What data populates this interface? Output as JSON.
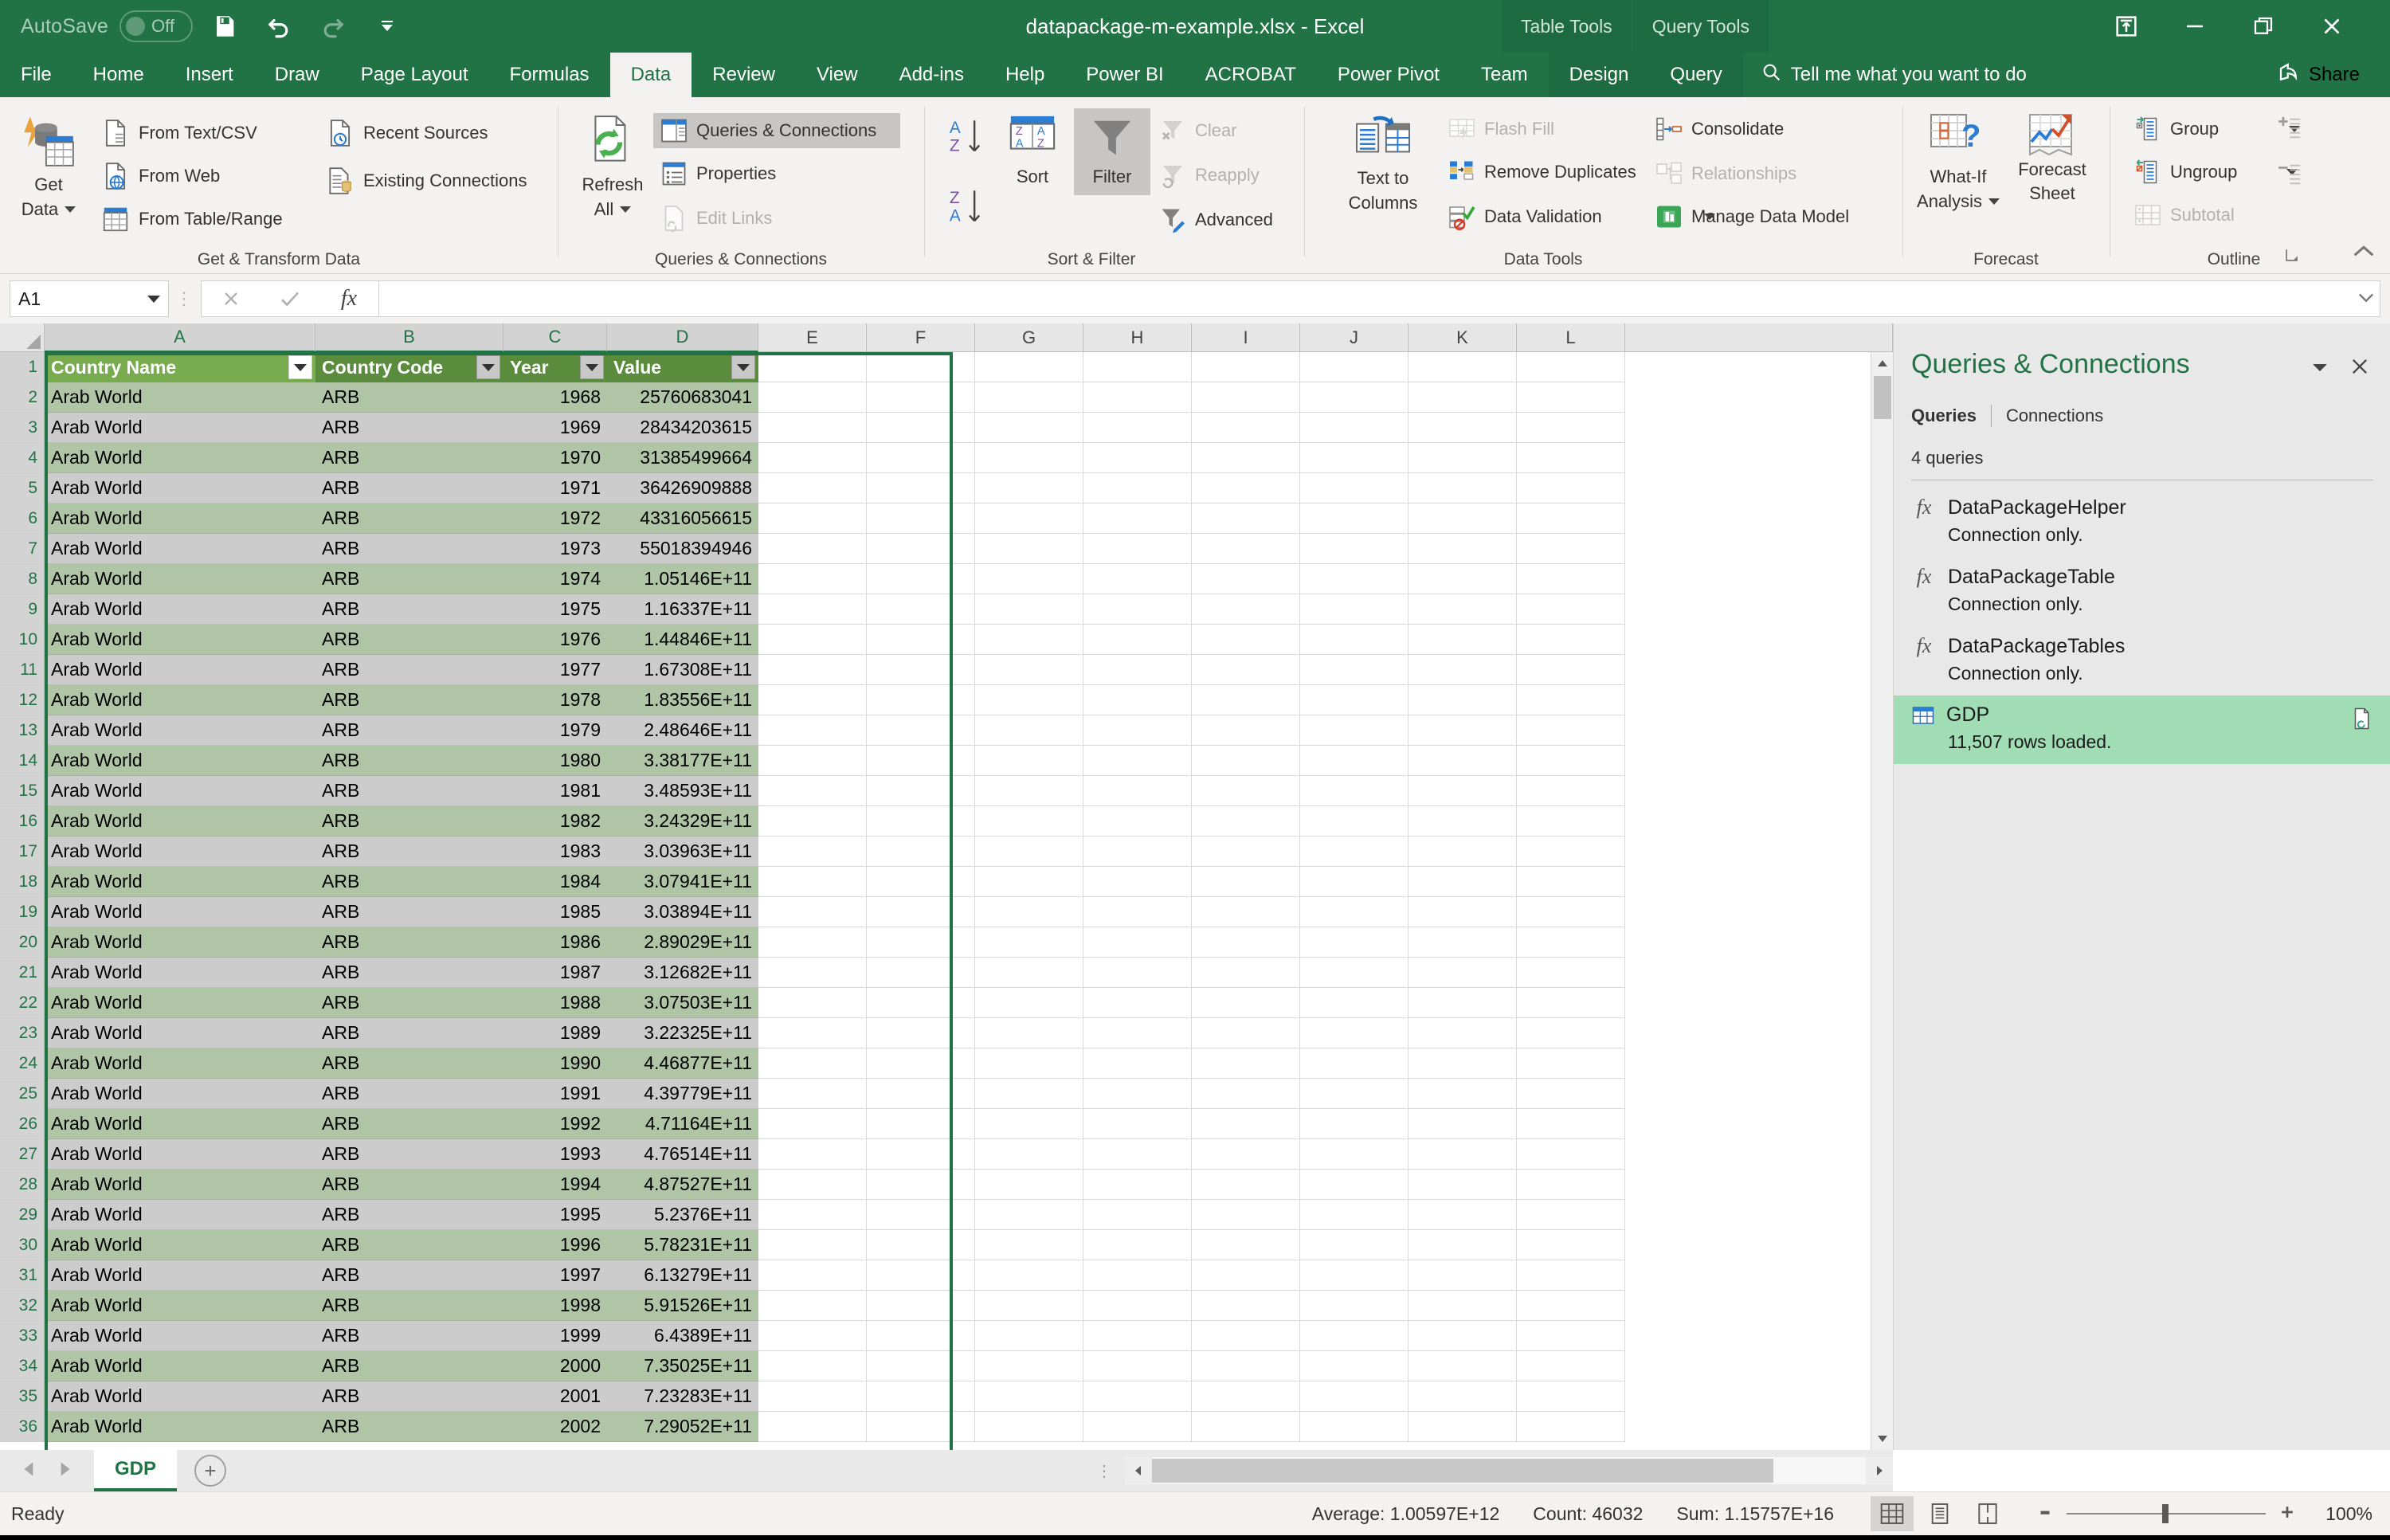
{
  "titlebar": {
    "autosave_label": "AutoSave",
    "autosave_state": "Off",
    "document_title": "datapackage-m-example.xlsx  -  Excel",
    "save_icon": "save-icon",
    "undo_icon": "undo-icon",
    "redo_icon": "redo-icon",
    "customize_qat_icon": "customize-quick-access-toolbar-icon",
    "context_tabs": [
      "Table Tools",
      "Query Tools"
    ],
    "ribbon_display_icon": "ribbon-display-options-icon",
    "minimize_icon": "minimize-icon",
    "restore_icon": "restore-icon",
    "close_icon": "close-icon"
  },
  "ribbon_tabs": {
    "items": [
      "File",
      "Home",
      "Insert",
      "Draw",
      "Page Layout",
      "Formulas",
      "Data",
      "Review",
      "View",
      "Add-ins",
      "Help",
      "Power BI",
      "ACROBAT",
      "Power Pivot",
      "Team"
    ],
    "active": "Data",
    "context_items": [
      "Design",
      "Query"
    ],
    "tell_me": "Tell me what you want to do",
    "tell_me_icon": "search-icon",
    "share_label": "Share",
    "share_icon": "share-icon"
  },
  "ribbon": {
    "groups": [
      {
        "name": "Get & Transform Data",
        "big_buttons": [
          {
            "label_line1": "Get",
            "label_line2": "Data",
            "icon": "get-data-icon",
            "has_caret": true
          }
        ],
        "small_buttons": [
          {
            "label": "From Text/CSV",
            "icon": "from-text-csv-icon",
            "disabled": false
          },
          {
            "label": "From Web",
            "icon": "from-web-icon",
            "disabled": false
          },
          {
            "label": "From Table/Range",
            "icon": "from-table-range-icon",
            "disabled": false
          },
          {
            "label": "Recent Sources",
            "icon": "recent-sources-icon",
            "disabled": false
          },
          {
            "label": "Existing Connections",
            "icon": "existing-connections-icon",
            "disabled": false
          }
        ]
      },
      {
        "name": "Queries & Connections",
        "big_buttons": [
          {
            "label_line1": "Refresh",
            "label_line2": "All",
            "icon": "refresh-all-icon",
            "has_caret": true
          }
        ],
        "small_buttons": [
          {
            "label": "Queries & Connections",
            "icon": "queries-connections-icon",
            "disabled": false,
            "pressed": true
          },
          {
            "label": "Properties",
            "icon": "properties-icon",
            "disabled": false
          },
          {
            "label": "Edit Links",
            "icon": "edit-links-icon",
            "disabled": true
          }
        ]
      },
      {
        "name": "Sort & Filter",
        "big_buttons": [
          {
            "label_line1": "Sort",
            "label_line2": "",
            "icon": "sort-icon",
            "has_caret": false
          },
          {
            "label_line1": "Filter",
            "label_line2": "",
            "icon": "filter-icon",
            "has_caret": false,
            "pressed": true
          }
        ],
        "small_buttons": [
          {
            "label": "Clear",
            "icon": "clear-filter-icon",
            "disabled": true
          },
          {
            "label": "Reapply",
            "icon": "reapply-filter-icon",
            "disabled": true
          },
          {
            "label": "Advanced",
            "icon": "advanced-filter-icon",
            "disabled": false
          }
        ],
        "sort_az_icon": "sort-ascending-icon",
        "sort_za_icon": "sort-descending-icon"
      },
      {
        "name": "Data Tools",
        "big_buttons": [
          {
            "label_line1": "Text to",
            "label_line2": "Columns",
            "icon": "text-to-columns-icon",
            "has_caret": false
          }
        ],
        "small_buttons": [
          {
            "label": "Flash Fill",
            "icon": "flash-fill-icon",
            "disabled": true
          },
          {
            "label": "Remove Duplicates",
            "icon": "remove-duplicates-icon",
            "disabled": false
          },
          {
            "label": "Data Validation",
            "icon": "data-validation-icon",
            "disabled": false,
            "has_caret": true
          },
          {
            "label": "Consolidate",
            "icon": "consolidate-icon",
            "disabled": false
          },
          {
            "label": "Relationships",
            "icon": "relationships-icon",
            "disabled": true
          },
          {
            "label": "Manage Data Model",
            "icon": "manage-data-model-icon",
            "disabled": false
          }
        ]
      },
      {
        "name": "Forecast",
        "big_buttons": [
          {
            "label_line1": "What-If",
            "label_line2": "Analysis",
            "icon": "what-if-analysis-icon",
            "has_caret": true
          },
          {
            "label_line1": "Forecast",
            "label_line2": "Sheet",
            "icon": "forecast-sheet-icon",
            "has_caret": false
          }
        ],
        "small_buttons": []
      },
      {
        "name": "Outline",
        "big_buttons": [],
        "small_buttons": [
          {
            "label": "Group",
            "icon": "group-icon",
            "disabled": false,
            "has_caret": true
          },
          {
            "label": "Ungroup",
            "icon": "ungroup-icon",
            "disabled": false,
            "has_caret": true
          },
          {
            "label": "Subtotal",
            "icon": "subtotal-icon",
            "disabled": true
          }
        ],
        "show_detail_icon": "show-detail-icon",
        "hide_detail_icon": "hide-detail-icon",
        "has_dialog_launcher": true
      }
    ],
    "collapse_icon": "collapse-ribbon-icon"
  },
  "formula_bar": {
    "name_box_value": "A1",
    "cancel_icon": "cancel-icon",
    "enter_icon": "enter-icon",
    "function_icon": "insert-function-icon",
    "formula_value": "",
    "expand_icon": "expand-formula-bar-icon"
  },
  "grid": {
    "column_headers": [
      "A",
      "B",
      "C",
      "D",
      "E",
      "F",
      "G",
      "H",
      "I",
      "J",
      "K",
      "L"
    ],
    "selected_columns": [
      "A",
      "B",
      "C",
      "D"
    ],
    "table_headers": [
      "Country Name",
      "Country Code",
      "Year",
      "Value"
    ],
    "row_numbers": [
      1,
      2,
      3,
      4,
      5,
      6,
      7,
      8,
      9,
      10,
      11,
      12,
      13,
      14,
      15,
      16,
      17,
      18,
      19,
      20,
      21,
      22,
      23,
      24,
      25,
      26,
      27,
      28,
      29,
      30,
      31,
      32,
      33,
      34,
      35,
      36
    ],
    "rows": [
      {
        "row": 2,
        "country_name": "Arab World",
        "country_code": "ARB",
        "year": "1968",
        "value": "25760683041"
      },
      {
        "row": 3,
        "country_name": "Arab World",
        "country_code": "ARB",
        "year": "1969",
        "value": "28434203615"
      },
      {
        "row": 4,
        "country_name": "Arab World",
        "country_code": "ARB",
        "year": "1970",
        "value": "31385499664"
      },
      {
        "row": 5,
        "country_name": "Arab World",
        "country_code": "ARB",
        "year": "1971",
        "value": "36426909888"
      },
      {
        "row": 6,
        "country_name": "Arab World",
        "country_code": "ARB",
        "year": "1972",
        "value": "43316056615"
      },
      {
        "row": 7,
        "country_name": "Arab World",
        "country_code": "ARB",
        "year": "1973",
        "value": "55018394946"
      },
      {
        "row": 8,
        "country_name": "Arab World",
        "country_code": "ARB",
        "year": "1974",
        "value": "1.05146E+11"
      },
      {
        "row": 9,
        "country_name": "Arab World",
        "country_code": "ARB",
        "year": "1975",
        "value": "1.16337E+11"
      },
      {
        "row": 10,
        "country_name": "Arab World",
        "country_code": "ARB",
        "year": "1976",
        "value": "1.44846E+11"
      },
      {
        "row": 11,
        "country_name": "Arab World",
        "country_code": "ARB",
        "year": "1977",
        "value": "1.67308E+11"
      },
      {
        "row": 12,
        "country_name": "Arab World",
        "country_code": "ARB",
        "year": "1978",
        "value": "1.83556E+11"
      },
      {
        "row": 13,
        "country_name": "Arab World",
        "country_code": "ARB",
        "year": "1979",
        "value": "2.48646E+11"
      },
      {
        "row": 14,
        "country_name": "Arab World",
        "country_code": "ARB",
        "year": "1980",
        "value": "3.38177E+11"
      },
      {
        "row": 15,
        "country_name": "Arab World",
        "country_code": "ARB",
        "year": "1981",
        "value": "3.48593E+11"
      },
      {
        "row": 16,
        "country_name": "Arab World",
        "country_code": "ARB",
        "year": "1982",
        "value": "3.24329E+11"
      },
      {
        "row": 17,
        "country_name": "Arab World",
        "country_code": "ARB",
        "year": "1983",
        "value": "3.03963E+11"
      },
      {
        "row": 18,
        "country_name": "Arab World",
        "country_code": "ARB",
        "year": "1984",
        "value": "3.07941E+11"
      },
      {
        "row": 19,
        "country_name": "Arab World",
        "country_code": "ARB",
        "year": "1985",
        "value": "3.03894E+11"
      },
      {
        "row": 20,
        "country_name": "Arab World",
        "country_code": "ARB",
        "year": "1986",
        "value": "2.89029E+11"
      },
      {
        "row": 21,
        "country_name": "Arab World",
        "country_code": "ARB",
        "year": "1987",
        "value": "3.12682E+11"
      },
      {
        "row": 22,
        "country_name": "Arab World",
        "country_code": "ARB",
        "year": "1988",
        "value": "3.07503E+11"
      },
      {
        "row": 23,
        "country_name": "Arab World",
        "country_code": "ARB",
        "year": "1989",
        "value": "3.22325E+11"
      },
      {
        "row": 24,
        "country_name": "Arab World",
        "country_code": "ARB",
        "year": "1990",
        "value": "4.46877E+11"
      },
      {
        "row": 25,
        "country_name": "Arab World",
        "country_code": "ARB",
        "year": "1991",
        "value": "4.39779E+11"
      },
      {
        "row": 26,
        "country_name": "Arab World",
        "country_code": "ARB",
        "year": "1992",
        "value": "4.71164E+11"
      },
      {
        "row": 27,
        "country_name": "Arab World",
        "country_code": "ARB",
        "year": "1993",
        "value": "4.76514E+11"
      },
      {
        "row": 28,
        "country_name": "Arab World",
        "country_code": "ARB",
        "year": "1994",
        "value": "4.87527E+11"
      },
      {
        "row": 29,
        "country_name": "Arab World",
        "country_code": "ARB",
        "year": "1995",
        "value": "5.2376E+11"
      },
      {
        "row": 30,
        "country_name": "Arab World",
        "country_code": "ARB",
        "year": "1996",
        "value": "5.78231E+11"
      },
      {
        "row": 31,
        "country_name": "Arab World",
        "country_code": "ARB",
        "year": "1997",
        "value": "6.13279E+11"
      },
      {
        "row": 32,
        "country_name": "Arab World",
        "country_code": "ARB",
        "year": "1998",
        "value": "5.91526E+11"
      },
      {
        "row": 33,
        "country_name": "Arab World",
        "country_code": "ARB",
        "year": "1999",
        "value": "6.4389E+11"
      },
      {
        "row": 34,
        "country_name": "Arab World",
        "country_code": "ARB",
        "year": "2000",
        "value": "7.35025E+11"
      },
      {
        "row": 35,
        "country_name": "Arab World",
        "country_code": "ARB",
        "year": "2001",
        "value": "7.23283E+11"
      },
      {
        "row": 36,
        "country_name": "Arab World",
        "country_code": "ARB",
        "year": "2002",
        "value": "7.29052E+11"
      }
    ]
  },
  "queries_pane": {
    "title": "Queries & Connections",
    "menu_icon": "pane-menu-icon",
    "close_icon": "close-icon",
    "tabs": [
      "Queries",
      "Connections"
    ],
    "active_tab": "Queries",
    "count_label": "4 queries",
    "items": [
      {
        "name": "DataPackageHelper",
        "status": "Connection only.",
        "icon": "fx-icon",
        "selected": false
      },
      {
        "name": "DataPackageTable",
        "status": "Connection only.",
        "icon": "fx-icon",
        "selected": false
      },
      {
        "name": "DataPackageTables",
        "status": "Connection only.",
        "icon": "fx-icon",
        "selected": false
      },
      {
        "name": "GDP",
        "status": "11,507 rows loaded.",
        "icon": "table-icon",
        "selected": true,
        "action_icon": "refresh-preview-icon"
      }
    ]
  },
  "sheet_bar": {
    "prev_icon": "previous-sheet-icon",
    "next_icon": "next-sheet-icon",
    "tabs": [
      "GDP"
    ],
    "active_tab": "GDP",
    "add_sheet_icon": "add-sheet-icon",
    "add_sheet_label": "+"
  },
  "status_bar": {
    "mode": "Ready",
    "average": "Average: 1.00597E+12",
    "count": "Count: 46032",
    "sum": "Sum: 1.15757E+16",
    "view_normal_icon": "normal-view-icon",
    "view_page_layout_icon": "page-layout-view-icon",
    "view_page_break_icon": "page-break-preview-icon",
    "zoom_out_icon": "zoom-out-icon",
    "zoom_in_icon": "zoom-in-icon",
    "zoom_level": "100%"
  },
  "colors": {
    "excel_green": "#217346",
    "ribbon_bg": "#f3f2f1",
    "table_header_green": "#5b8c3e",
    "table_band_green": "#b0c4a6",
    "selection_gray": "#cccccc",
    "query_selected_green": "#a0dcb4"
  }
}
